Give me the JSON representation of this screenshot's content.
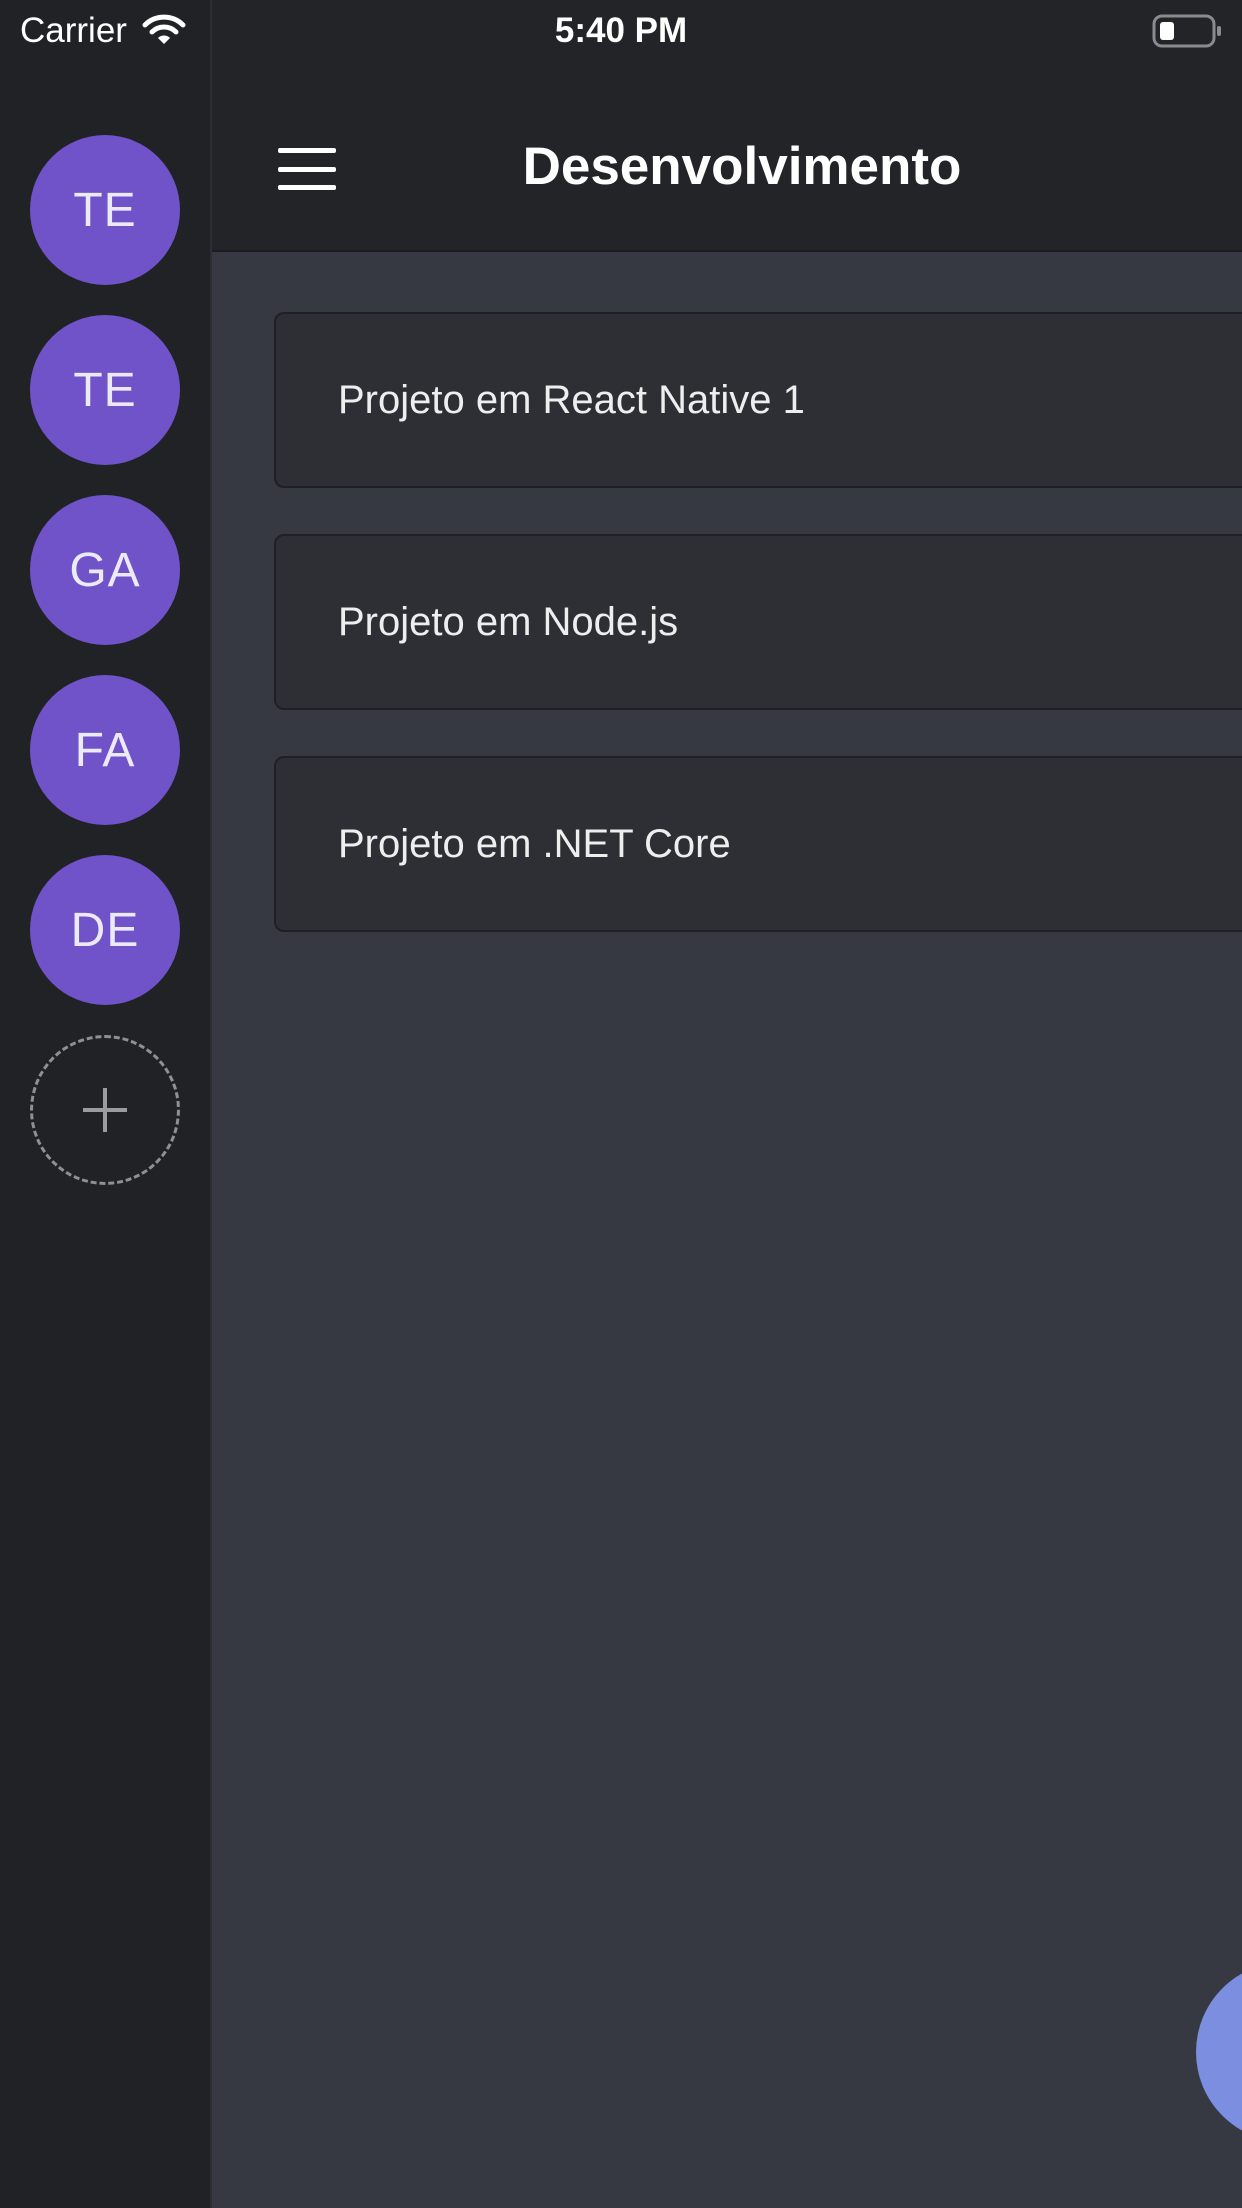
{
  "status_bar": {
    "carrier": "Carrier",
    "time": "5:40 PM",
    "wifi_icon": "wifi-icon",
    "battery_icon": "battery-icon"
  },
  "sidebar": {
    "avatars": [
      {
        "label": "TE"
      },
      {
        "label": "TE"
      },
      {
        "label": "GA"
      },
      {
        "label": "FA"
      },
      {
        "label": "DE"
      }
    ],
    "add_icon": "plus-icon",
    "avatar_color": "#7053c8"
  },
  "header": {
    "title": "Desenvolvimento",
    "menu_icon": "hamburger-menu-icon"
  },
  "projects": [
    {
      "name": "Projeto em React Native 1"
    },
    {
      "name": "Projeto em Node.js"
    },
    {
      "name": "Projeto em .NET Core"
    }
  ],
  "colors": {
    "background": "#363941",
    "sidebar": "#202225",
    "card": "#2d2f34",
    "fab": "#7b8ee0"
  }
}
